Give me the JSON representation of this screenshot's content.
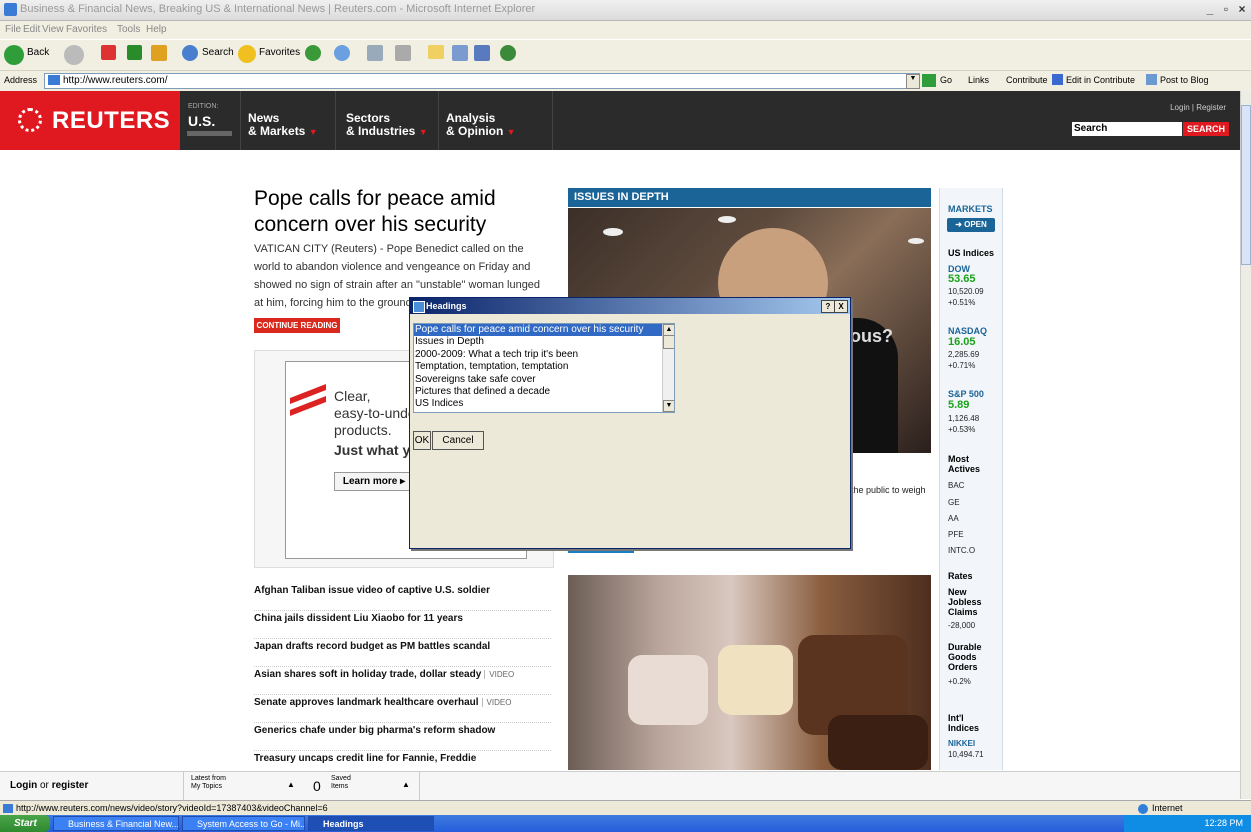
{
  "window": {
    "title": "Business & Financial News, Breaking US & International News | Reuters.com - Microsoft Internet Explorer"
  },
  "menu": [
    "File",
    "Edit",
    "View",
    "Favorites",
    "Tools",
    "Help"
  ],
  "toolbar": {
    "back": "Back",
    "search": "Search",
    "favorites": "Favorites"
  },
  "address": {
    "label": "Address",
    "url": "http://www.reuters.com/",
    "go": "Go",
    "links": "Links",
    "contribute": "Contribute",
    "edit_contribute": "Edit in Contribute",
    "post_blog": "Post to Blog"
  },
  "site": {
    "logo": "REUTERS",
    "edition_label": "EDITION:",
    "edition": "U.S.",
    "nav": [
      {
        "line1": "News",
        "line2": "& Markets"
      },
      {
        "line1": "Sectors",
        "line2": "& Industries"
      },
      {
        "line1": "Analysis",
        "line2": "& Opinion"
      }
    ],
    "login": "Login",
    "register": "Register",
    "search_placeholder": "Search",
    "search_button": "SEARCH"
  },
  "main": {
    "headline": "Pope calls for peace amid concern over his security",
    "lede": "VATICAN CITY (Reuters) - Pope Benedict called on the world to abandon violence and vengeance on Friday and showed no sign of strain after an \"unstable\" woman lunged at him, forcing him to the ground",
    "continue": "CONTINUE READING",
    "ad": {
      "line1": "Clear,",
      "line2": "easy-to-unde",
      "line3": "products.",
      "line4": "Just what yo",
      "learn": "Learn more ▸"
    },
    "stories": [
      {
        "title": "Afghan Taliban issue video of captive U.S. soldier",
        "video": ""
      },
      {
        "title": "China jails dissident Liu Xiaobo for 11 years",
        "video": ""
      },
      {
        "title": "Japan drafts record budget as PM battles scandal",
        "video": ""
      },
      {
        "title": "Asian shares soft in holiday trade, dollar steady",
        "video": "VIDEO"
      },
      {
        "title": "Senate approves landmark healthcare overhaul",
        "video": "VIDEO"
      },
      {
        "title": "Generics chafe under big pharma's reform shadow",
        "video": ""
      },
      {
        "title": "Treasury uncaps credit line for Fannie, Freddie",
        "video": ""
      }
    ]
  },
  "issues": {
    "header": "ISSUES IN DEPTH",
    "shirt_text": "ous?",
    "caption": "the public to weigh"
  },
  "markets": {
    "title": "MARKETS",
    "open": "OPEN",
    "us_indices": "US Indices",
    "dow": {
      "name": "DOW",
      "change": "53.65",
      "value": "10,520.09",
      "pct": "+0.51%"
    },
    "nasdaq": {
      "name": "NASDAQ",
      "change": "16.05",
      "value": "2,285.69",
      "pct": "+0.71%"
    },
    "sp500": {
      "name": "S&P 500",
      "change": "5.89",
      "value": "1,126.48",
      "pct": "+0.53%"
    },
    "most_actives": "Most Actives",
    "actives": [
      "BAC",
      "GE",
      "AA",
      "PFE",
      "INTC.O"
    ],
    "rates": "Rates",
    "jobless": {
      "label": "New Jobless Claims",
      "value": "-28,000"
    },
    "durable": {
      "label": "Durable Goods Orders",
      "value": "+0.2%"
    },
    "intl": "Int'l Indices",
    "nikkei": {
      "name": "NIKKEI",
      "value": "10,494.71"
    }
  },
  "dialog": {
    "title": "Headings",
    "help": "?",
    "close": "X",
    "items": [
      "Pope calls for peace amid concern over his security",
      "Issues in Depth",
      "2000-2009: What a tech trip it's been",
      "Temptation, temptation, temptation",
      "Sovereigns take safe cover",
      "Pictures that defined a decade",
      "US Indices"
    ],
    "selected_index": 0,
    "ok": "OK",
    "cancel": "Cancel"
  },
  "footer": {
    "login": "Login",
    "or": "or",
    "register": "register",
    "latest1": "Latest from",
    "latest2": "My Topics",
    "saved_count": "0",
    "saved1": "Saved",
    "saved2": "Items"
  },
  "status": {
    "url": "http://www.reuters.com/news/video/story?videoId=17387403&videoChannel=6",
    "zone": "Internet"
  },
  "taskbar": {
    "start": "Start",
    "tasks": [
      "Business & Financial New...",
      "System Access to Go - Mi...",
      "Headings"
    ],
    "clock": "12:28 PM"
  }
}
